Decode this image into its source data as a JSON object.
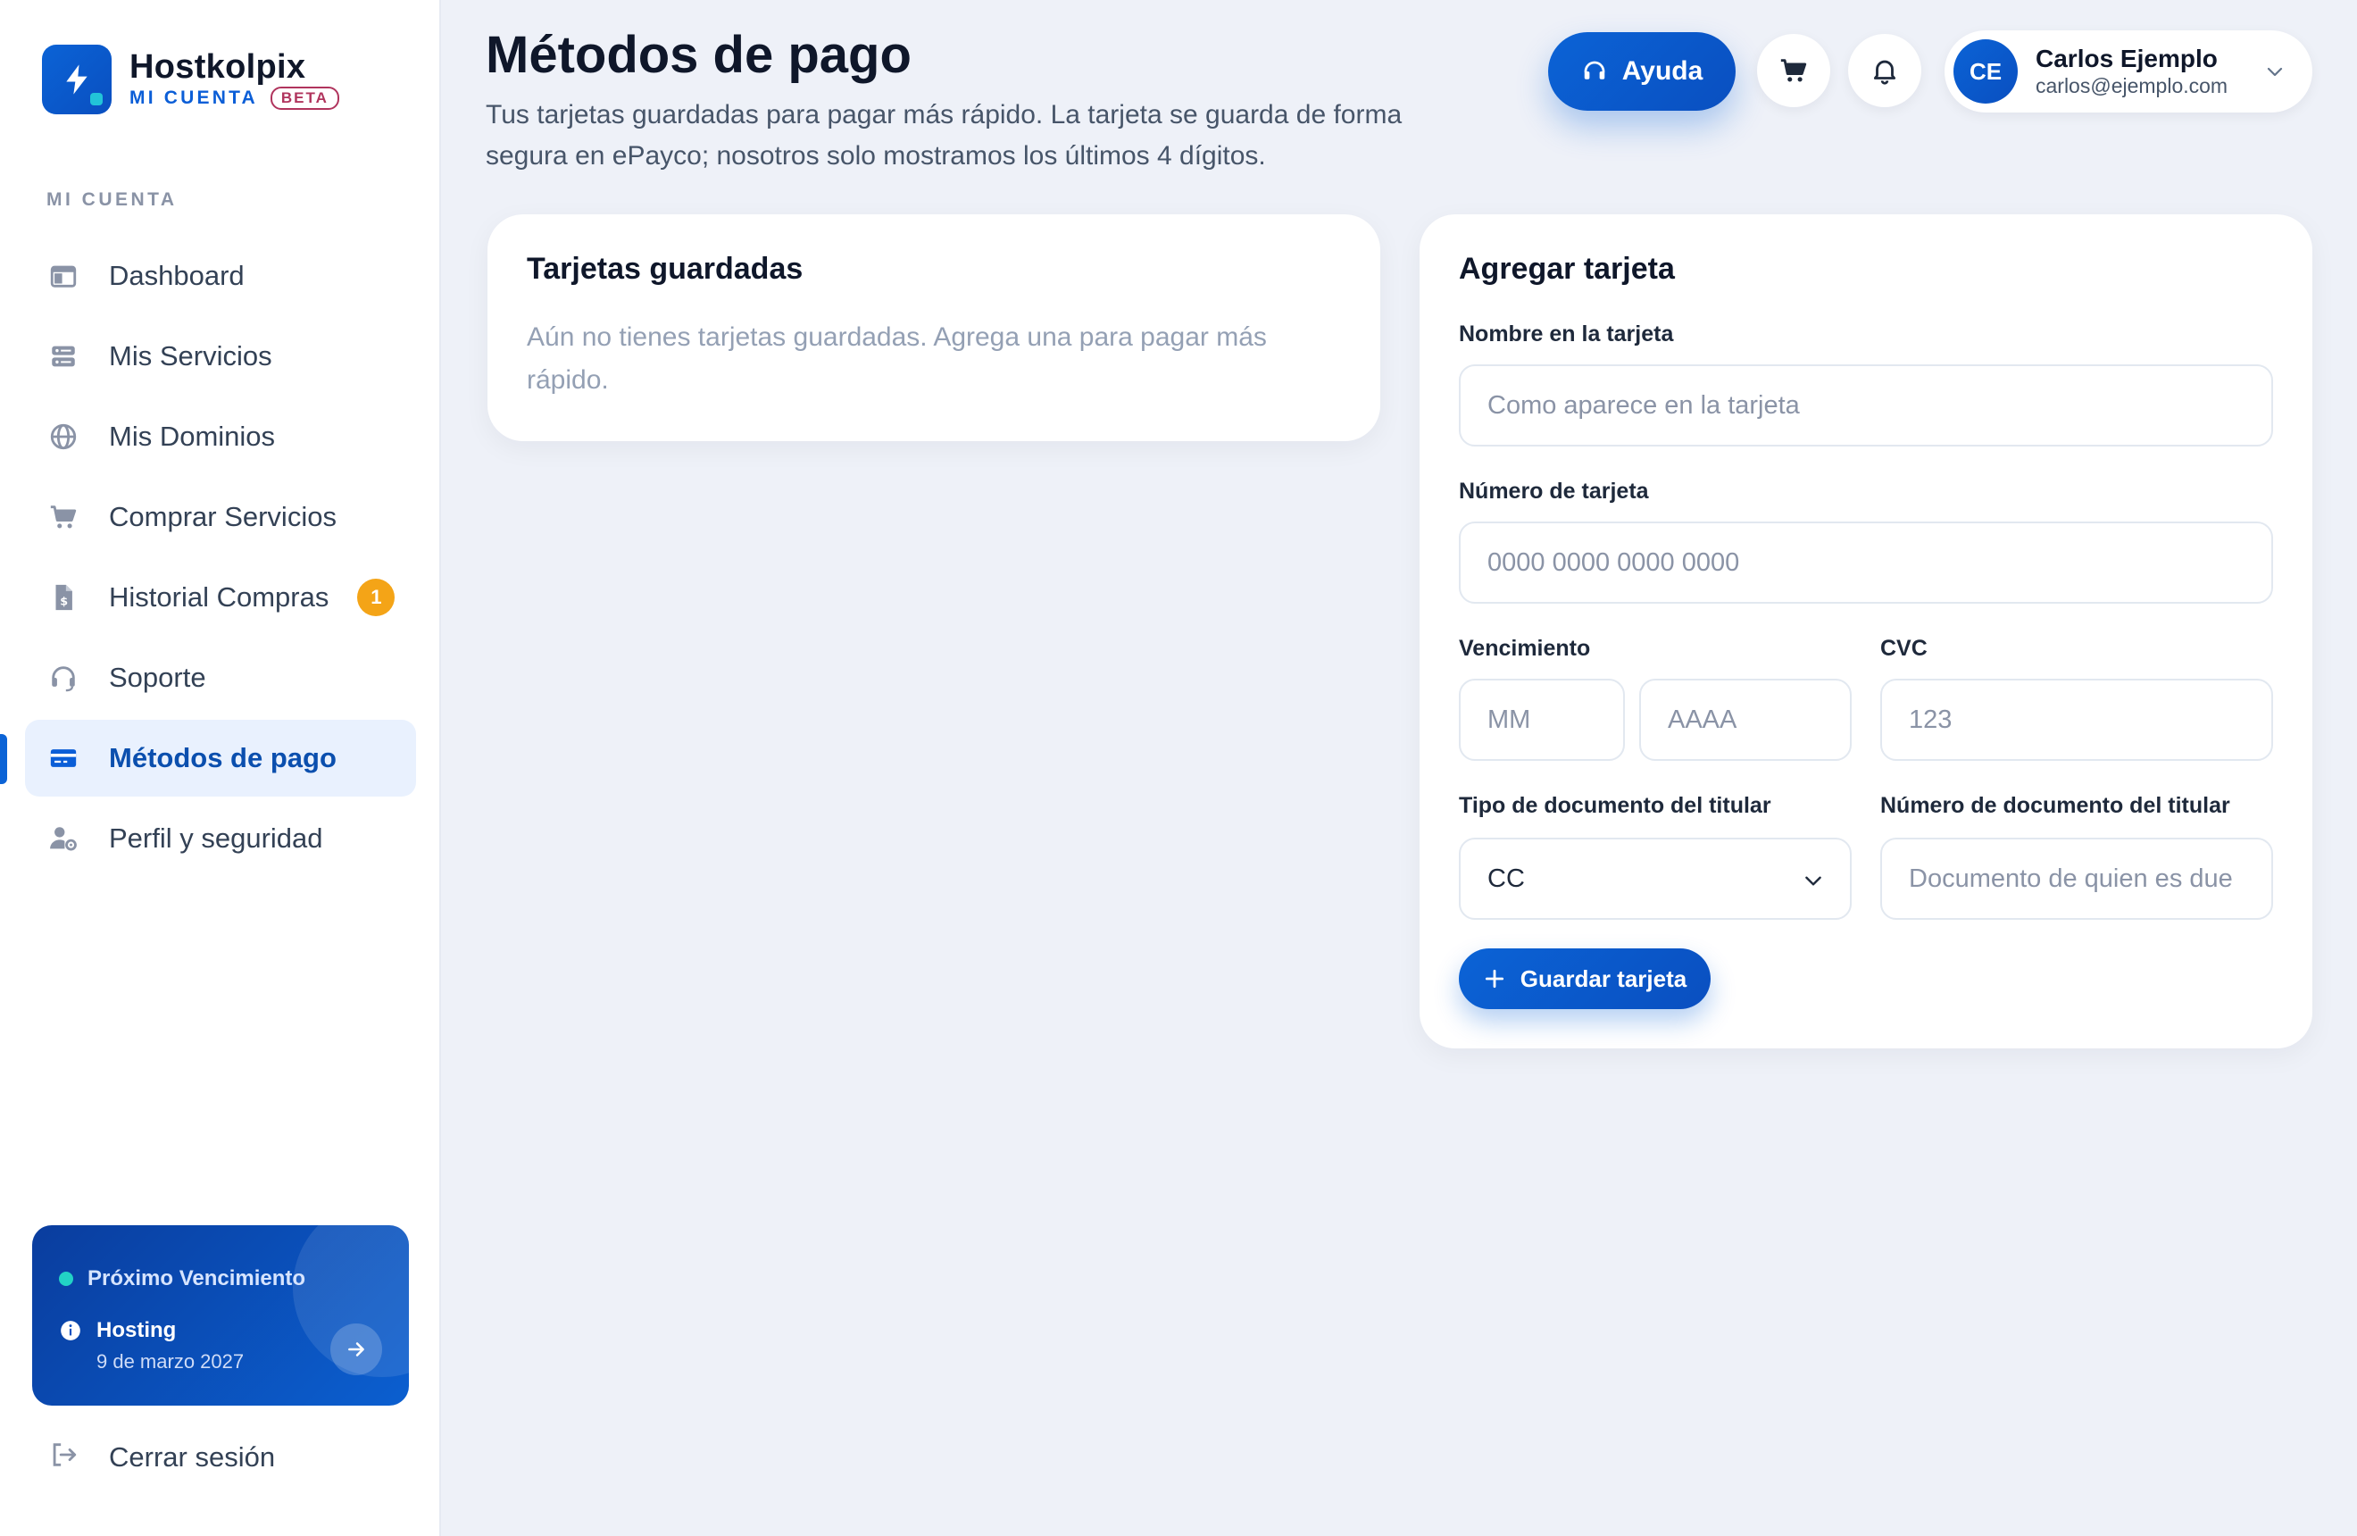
{
  "brand": {
    "name": "Hostkolpix",
    "sub_label": "MI CUENTA",
    "beta": "BETA"
  },
  "sidebar": {
    "section_label": "MI CUENTA",
    "items": [
      {
        "label": "Dashboard",
        "icon": "dashboard-icon"
      },
      {
        "label": "Mis Servicios",
        "icon": "server-icon"
      },
      {
        "label": "Mis Dominios",
        "icon": "globe-icon"
      },
      {
        "label": "Comprar Servicios",
        "icon": "cart-icon"
      },
      {
        "label": "Historial Compras",
        "icon": "invoice-icon",
        "badge": "1"
      },
      {
        "label": "Soporte",
        "icon": "headset-icon"
      },
      {
        "label": "Métodos de pago",
        "icon": "credit-card-icon",
        "active": true
      },
      {
        "label": "Perfil y seguridad",
        "icon": "user-cog-icon"
      }
    ],
    "expiry": {
      "title": "Próximo Vencimiento",
      "service": "Hosting",
      "date": "9 de marzo 2027"
    },
    "logout_label": "Cerrar sesión"
  },
  "header": {
    "title": "Métodos de pago",
    "subtitle": "Tus tarjetas guardadas para pagar más rápido. La tarjeta se guarda de forma segura en ePayco; nosotros solo mostramos los últimos 4 dígitos.",
    "help_label": "Ayuda",
    "user": {
      "initials": "CE",
      "name": "Carlos Ejemplo",
      "email": "carlos@ejemplo.com"
    }
  },
  "saved_cards": {
    "title": "Tarjetas guardadas",
    "empty_message": "Aún no tienes tarjetas guardadas. Agrega una para pagar más rápido."
  },
  "add_card": {
    "title": "Agregar tarjeta",
    "name_label": "Nombre en la tarjeta",
    "name_placeholder": "Como aparece en la tarjeta",
    "number_label": "Número de tarjeta",
    "number_placeholder": "0000 0000 0000 0000",
    "expiry_label": "Vencimiento",
    "month_placeholder": "MM",
    "year_placeholder": "AAAA",
    "cvc_label": "CVC",
    "cvc_placeholder": "123",
    "doc_type_label": "Tipo de documento del titular",
    "doc_type_value": "CC",
    "doc_number_label": "Número de documento del titular",
    "doc_number_placeholder": "Documento de quien es due",
    "save_label": "Guardar tarjeta"
  },
  "colors": {
    "primary": "#0b63d6",
    "background": "#eef1f8",
    "badge": "#f4a417",
    "active_bg": "#e9f1fe"
  }
}
